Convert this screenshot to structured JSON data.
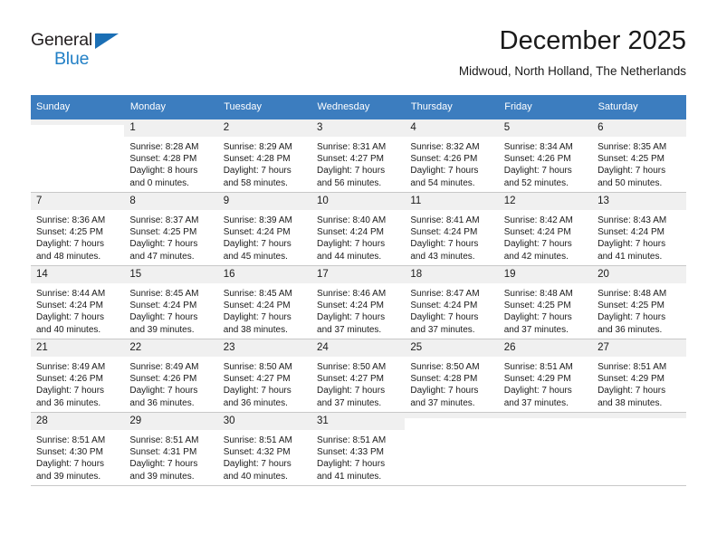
{
  "brand": {
    "name_top": "General",
    "name_bottom": "Blue",
    "colors": {
      "dark": "#231f20",
      "blue": "#2280c6",
      "triangle": "#1b6fb5"
    }
  },
  "header": {
    "title": "December 2025",
    "subtitle": "Midwoud, North Holland, The Netherlands"
  },
  "theme": {
    "header_row_bg": "#3c7dbf",
    "daynum_bg": "#f0f0f0",
    "grid_line": "#c8c8c8",
    "text": "#1a1a1a"
  },
  "weekdays": [
    "Sunday",
    "Monday",
    "Tuesday",
    "Wednesday",
    "Thursday",
    "Friday",
    "Saturday"
  ],
  "weeks": [
    [
      {
        "day": "",
        "empty": true,
        "sunrise": "",
        "sunset": "",
        "daylight_line1": "",
        "daylight_line2": ""
      },
      {
        "day": "1",
        "sunrise": "Sunrise: 8:28 AM",
        "sunset": "Sunset: 4:28 PM",
        "daylight_line1": "Daylight: 8 hours",
        "daylight_line2": "and 0 minutes."
      },
      {
        "day": "2",
        "sunrise": "Sunrise: 8:29 AM",
        "sunset": "Sunset: 4:28 PM",
        "daylight_line1": "Daylight: 7 hours",
        "daylight_line2": "and 58 minutes."
      },
      {
        "day": "3",
        "sunrise": "Sunrise: 8:31 AM",
        "sunset": "Sunset: 4:27 PM",
        "daylight_line1": "Daylight: 7 hours",
        "daylight_line2": "and 56 minutes."
      },
      {
        "day": "4",
        "sunrise": "Sunrise: 8:32 AM",
        "sunset": "Sunset: 4:26 PM",
        "daylight_line1": "Daylight: 7 hours",
        "daylight_line2": "and 54 minutes."
      },
      {
        "day": "5",
        "sunrise": "Sunrise: 8:34 AM",
        "sunset": "Sunset: 4:26 PM",
        "daylight_line1": "Daylight: 7 hours",
        "daylight_line2": "and 52 minutes."
      },
      {
        "day": "6",
        "sunrise": "Sunrise: 8:35 AM",
        "sunset": "Sunset: 4:25 PM",
        "daylight_line1": "Daylight: 7 hours",
        "daylight_line2": "and 50 minutes."
      }
    ],
    [
      {
        "day": "7",
        "sunrise": "Sunrise: 8:36 AM",
        "sunset": "Sunset: 4:25 PM",
        "daylight_line1": "Daylight: 7 hours",
        "daylight_line2": "and 48 minutes."
      },
      {
        "day": "8",
        "sunrise": "Sunrise: 8:37 AM",
        "sunset": "Sunset: 4:25 PM",
        "daylight_line1": "Daylight: 7 hours",
        "daylight_line2": "and 47 minutes."
      },
      {
        "day": "9",
        "sunrise": "Sunrise: 8:39 AM",
        "sunset": "Sunset: 4:24 PM",
        "daylight_line1": "Daylight: 7 hours",
        "daylight_line2": "and 45 minutes."
      },
      {
        "day": "10",
        "sunrise": "Sunrise: 8:40 AM",
        "sunset": "Sunset: 4:24 PM",
        "daylight_line1": "Daylight: 7 hours",
        "daylight_line2": "and 44 minutes."
      },
      {
        "day": "11",
        "sunrise": "Sunrise: 8:41 AM",
        "sunset": "Sunset: 4:24 PM",
        "daylight_line1": "Daylight: 7 hours",
        "daylight_line2": "and 43 minutes."
      },
      {
        "day": "12",
        "sunrise": "Sunrise: 8:42 AM",
        "sunset": "Sunset: 4:24 PM",
        "daylight_line1": "Daylight: 7 hours",
        "daylight_line2": "and 42 minutes."
      },
      {
        "day": "13",
        "sunrise": "Sunrise: 8:43 AM",
        "sunset": "Sunset: 4:24 PM",
        "daylight_line1": "Daylight: 7 hours",
        "daylight_line2": "and 41 minutes."
      }
    ],
    [
      {
        "day": "14",
        "sunrise": "Sunrise: 8:44 AM",
        "sunset": "Sunset: 4:24 PM",
        "daylight_line1": "Daylight: 7 hours",
        "daylight_line2": "and 40 minutes."
      },
      {
        "day": "15",
        "sunrise": "Sunrise: 8:45 AM",
        "sunset": "Sunset: 4:24 PM",
        "daylight_line1": "Daylight: 7 hours",
        "daylight_line2": "and 39 minutes."
      },
      {
        "day": "16",
        "sunrise": "Sunrise: 8:45 AM",
        "sunset": "Sunset: 4:24 PM",
        "daylight_line1": "Daylight: 7 hours",
        "daylight_line2": "and 38 minutes."
      },
      {
        "day": "17",
        "sunrise": "Sunrise: 8:46 AM",
        "sunset": "Sunset: 4:24 PM",
        "daylight_line1": "Daylight: 7 hours",
        "daylight_line2": "and 37 minutes."
      },
      {
        "day": "18",
        "sunrise": "Sunrise: 8:47 AM",
        "sunset": "Sunset: 4:24 PM",
        "daylight_line1": "Daylight: 7 hours",
        "daylight_line2": "and 37 minutes."
      },
      {
        "day": "19",
        "sunrise": "Sunrise: 8:48 AM",
        "sunset": "Sunset: 4:25 PM",
        "daylight_line1": "Daylight: 7 hours",
        "daylight_line2": "and 37 minutes."
      },
      {
        "day": "20",
        "sunrise": "Sunrise: 8:48 AM",
        "sunset": "Sunset: 4:25 PM",
        "daylight_line1": "Daylight: 7 hours",
        "daylight_line2": "and 36 minutes."
      }
    ],
    [
      {
        "day": "21",
        "sunrise": "Sunrise: 8:49 AM",
        "sunset": "Sunset: 4:26 PM",
        "daylight_line1": "Daylight: 7 hours",
        "daylight_line2": "and 36 minutes."
      },
      {
        "day": "22",
        "sunrise": "Sunrise: 8:49 AM",
        "sunset": "Sunset: 4:26 PM",
        "daylight_line1": "Daylight: 7 hours",
        "daylight_line2": "and 36 minutes."
      },
      {
        "day": "23",
        "sunrise": "Sunrise: 8:50 AM",
        "sunset": "Sunset: 4:27 PM",
        "daylight_line1": "Daylight: 7 hours",
        "daylight_line2": "and 36 minutes."
      },
      {
        "day": "24",
        "sunrise": "Sunrise: 8:50 AM",
        "sunset": "Sunset: 4:27 PM",
        "daylight_line1": "Daylight: 7 hours",
        "daylight_line2": "and 37 minutes."
      },
      {
        "day": "25",
        "sunrise": "Sunrise: 8:50 AM",
        "sunset": "Sunset: 4:28 PM",
        "daylight_line1": "Daylight: 7 hours",
        "daylight_line2": "and 37 minutes."
      },
      {
        "day": "26",
        "sunrise": "Sunrise: 8:51 AM",
        "sunset": "Sunset: 4:29 PM",
        "daylight_line1": "Daylight: 7 hours",
        "daylight_line2": "and 37 minutes."
      },
      {
        "day": "27",
        "sunrise": "Sunrise: 8:51 AM",
        "sunset": "Sunset: 4:29 PM",
        "daylight_line1": "Daylight: 7 hours",
        "daylight_line2": "and 38 minutes."
      }
    ],
    [
      {
        "day": "28",
        "sunrise": "Sunrise: 8:51 AM",
        "sunset": "Sunset: 4:30 PM",
        "daylight_line1": "Daylight: 7 hours",
        "daylight_line2": "and 39 minutes."
      },
      {
        "day": "29",
        "sunrise": "Sunrise: 8:51 AM",
        "sunset": "Sunset: 4:31 PM",
        "daylight_line1": "Daylight: 7 hours",
        "daylight_line2": "and 39 minutes."
      },
      {
        "day": "30",
        "sunrise": "Sunrise: 8:51 AM",
        "sunset": "Sunset: 4:32 PM",
        "daylight_line1": "Daylight: 7 hours",
        "daylight_line2": "and 40 minutes."
      },
      {
        "day": "31",
        "sunrise": "Sunrise: 8:51 AM",
        "sunset": "Sunset: 4:33 PM",
        "daylight_line1": "Daylight: 7 hours",
        "daylight_line2": "and 41 minutes."
      },
      {
        "day": "",
        "empty": true,
        "sunrise": "",
        "sunset": "",
        "daylight_line1": "",
        "daylight_line2": ""
      },
      {
        "day": "",
        "empty": true,
        "sunrise": "",
        "sunset": "",
        "daylight_line1": "",
        "daylight_line2": ""
      },
      {
        "day": "",
        "empty": true,
        "sunrise": "",
        "sunset": "",
        "daylight_line1": "",
        "daylight_line2": ""
      }
    ]
  ]
}
